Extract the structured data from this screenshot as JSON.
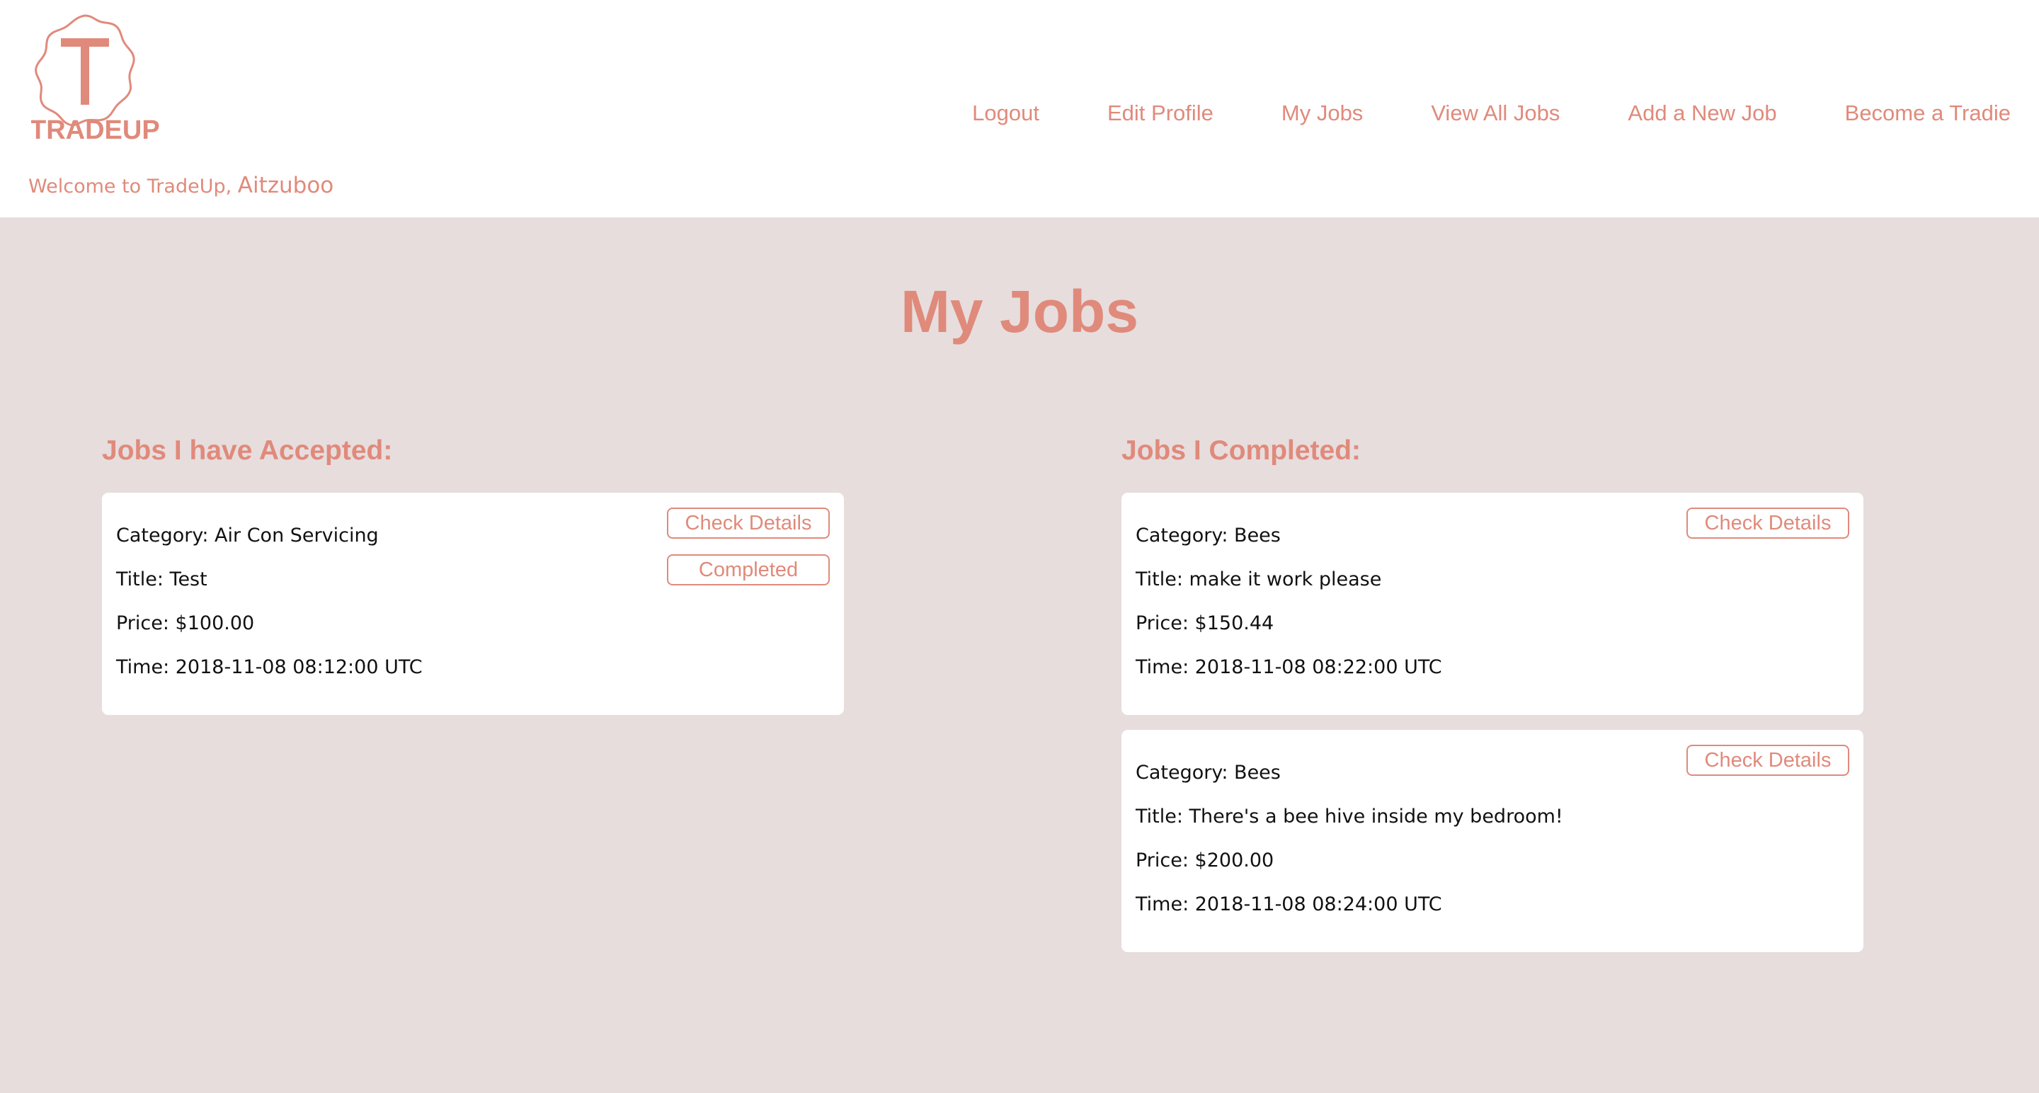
{
  "brand": {
    "logo_letter": "T",
    "logo_text": "TRADEUP",
    "accent_color": "#e08a7b",
    "background_color": "#e7dddd"
  },
  "welcome": {
    "prefix": "Welcome to TradeUp, ",
    "user_name": "Aitzuboo"
  },
  "nav": {
    "logout": "Logout",
    "edit_profile": "Edit Profile",
    "my_jobs": "My Jobs",
    "view_all_jobs": "View All Jobs",
    "add_new_job": "Add a New Job",
    "become_tradie": "Become a Tradie"
  },
  "page": {
    "title": "My Jobs"
  },
  "accepted": {
    "heading": "Jobs I have Accepted:",
    "jobs": [
      {
        "category": "Category: Air Con Servicing",
        "title": "Title: Test",
        "price": "Price: $100.00",
        "time": "Time: 2018-11-08 08:12:00 UTC",
        "check_details_label": "Check Details",
        "completed_label": "Completed"
      }
    ]
  },
  "completed": {
    "heading": "Jobs I Completed:",
    "jobs": [
      {
        "category": "Category: Bees",
        "title": "Title: make it work please",
        "price": "Price: $150.44",
        "time": "Time: 2018-11-08 08:22:00 UTC",
        "check_details_label": "Check Details"
      },
      {
        "category": "Category: Bees",
        "title": "Title: There's a bee hive inside my bedroom!",
        "price": "Price: $200.00",
        "time": "Time: 2018-11-08 08:24:00 UTC",
        "check_details_label": "Check Details"
      }
    ]
  }
}
